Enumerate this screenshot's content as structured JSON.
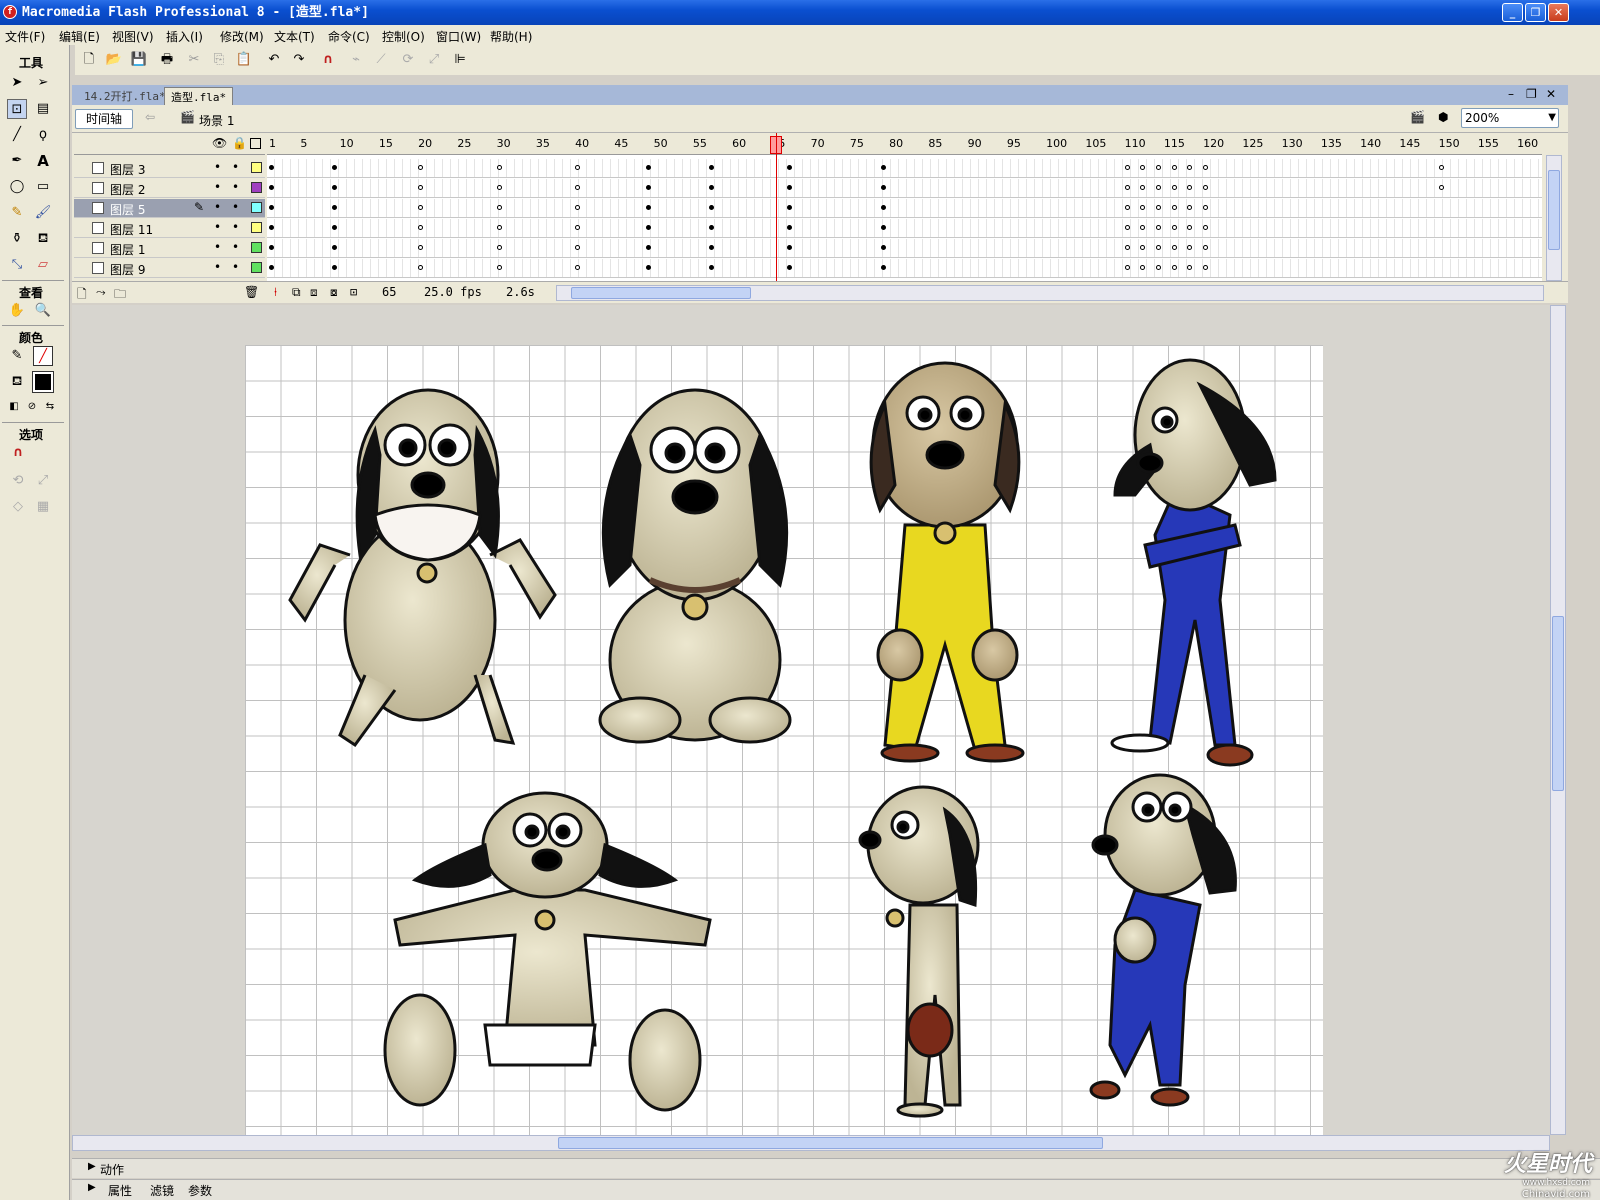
{
  "window": {
    "title": "Macromedia Flash Professional 8 - [造型.fla*]"
  },
  "menu": [
    "文件(F)",
    "编辑(E)",
    "视图(V)",
    "插入(I)",
    "修改(M)",
    "文本(T)",
    "命令(C)",
    "控制(O)",
    "窗口(W)",
    "帮助(H)"
  ],
  "toolbox": {
    "tools_header": "工具",
    "view_header": "查看",
    "colors_header": "颜色",
    "options_header": "选项"
  },
  "tabs": [
    "14.2开打.fla*",
    "造型.fla*"
  ],
  "scene": {
    "timeline_button": "时间轴",
    "scene_label": "场景 1",
    "zoom": "200%"
  },
  "timeline": {
    "ruler": [
      "1",
      "5",
      "10",
      "15",
      "20",
      "25",
      "30",
      "35",
      "40",
      "45",
      "50",
      "55",
      "60",
      "65",
      "70",
      "75",
      "80",
      "85",
      "90",
      "95",
      "100",
      "105",
      "110",
      "115",
      "120",
      "125",
      "130",
      "135",
      "140",
      "145",
      "150",
      "155",
      "160"
    ],
    "layers": [
      {
        "name": "图层 3",
        "color": "#ffff80"
      },
      {
        "name": "图层 2",
        "color": "#a040c0"
      },
      {
        "name": "图层 5",
        "color": "#80ffff",
        "selected": true
      },
      {
        "name": "图层 11",
        "color": "#ffff80"
      },
      {
        "name": "图层 1",
        "color": "#60e060"
      },
      {
        "name": "图层 9",
        "color": "#60e060"
      }
    ],
    "current_frame": "65",
    "fps": "25.0 fps",
    "elapsed": "2.6s"
  },
  "panels": {
    "actions": "动作",
    "properties": "属性",
    "filters": "滤镜",
    "parameters": "参数"
  },
  "watermark": {
    "brand": "火星时代",
    "url": "www.hxsd.com",
    "source": "Chinavid.com"
  },
  "icons": [
    "flash-app-icon",
    "arrow-tool-icon",
    "subselect-tool-icon",
    "free-transform-icon",
    "gradient-transform-icon",
    "line-tool-icon",
    "lasso-tool-icon",
    "pen-tool-icon",
    "text-tool-icon",
    "oval-tool-icon",
    "rect-tool-icon",
    "pencil-tool-icon",
    "brush-tool-icon",
    "ink-bottle-icon",
    "paint-bucket-icon",
    "eyedropper-icon",
    "eraser-icon",
    "hand-tool-icon",
    "zoom-tool-icon",
    "magnet-icon"
  ]
}
